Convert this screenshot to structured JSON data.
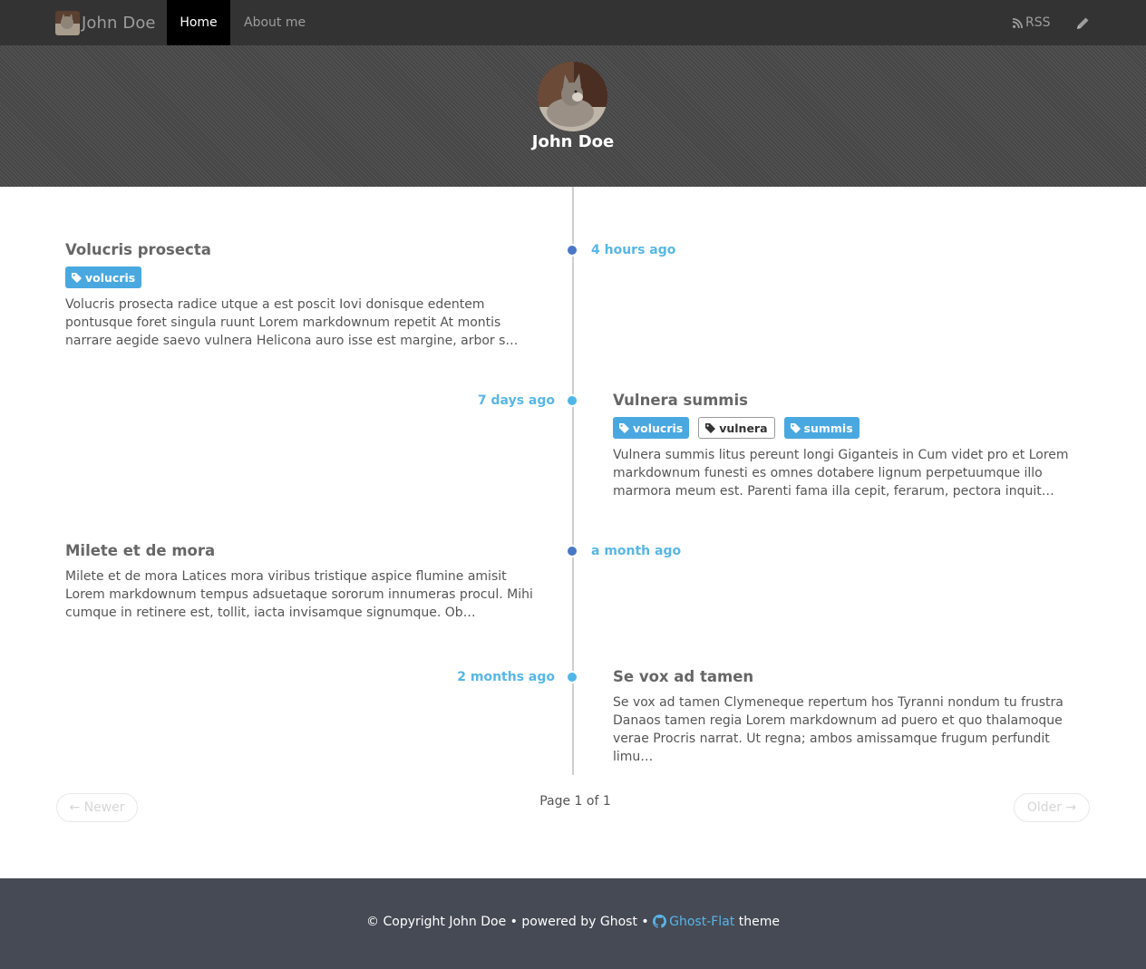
{
  "nav": {
    "brand_name": "John Doe",
    "home_label": "Home",
    "about_label": "About me",
    "rss_label": "RSS"
  },
  "header": {
    "name": "John Doe"
  },
  "posts": [
    {
      "title": "Volucris prosecta",
      "time": "4 hours ago",
      "tags": [
        "volucris"
      ],
      "excerpt": "Volucris prosecta radice utque a est poscit Iovi donisque edentem pontusque foret singula ruunt Lorem markdownum repetit At montis narrare aegide saevo vulnera Helicona auro isse est margine, arbor s…"
    },
    {
      "title": "Vulnera summis",
      "time": "7 days ago",
      "tags": [
        "volucris",
        "vulnera",
        "summis"
      ],
      "excerpt": "Vulnera summis litus pereunt longi Giganteis in Cum videt pro et Lorem markdownum funesti es omnes dotabere lignum perpetuumque illo marmora meum est. Parenti fama illa cepit, ferarum, pectora inquit…"
    },
    {
      "title": "Milete et de mora",
      "time": "a month ago",
      "tags": [],
      "excerpt": "Milete et de mora Latices mora viribus tristique aspice flumine amisit Lorem markdownum tempus adsuetaque sororum innumeras procul. Mihi cumque in retinere est, tollit, iacta invisamque signumque. Ob…"
    },
    {
      "title": "Se vox ad tamen",
      "time": "2 months ago",
      "tags": [],
      "excerpt": "Se vox ad tamen Clymeneque repertum hos Tyranni nondum tu frustra Danaos tamen regia Lorem markdownum ad puero et quo thalamoque verae Procris narrat. Ut regna; ambos amissamque frugum perfundit limu…"
    }
  ],
  "pagination": {
    "newer_label": "← Newer",
    "older_label": "Older →",
    "page_info": "Page 1 of 1"
  },
  "footer": {
    "copyright": "© Copyright John Doe • powered by Ghost •",
    "theme_link": "Ghost-Flat",
    "theme_suffix": "theme"
  },
  "colors": {
    "accent": "#57b7e6",
    "tag_blue": "#4aa8e0",
    "navbar_bg": "#333333",
    "footer_bg": "#454a54",
    "dot_dark": "#4a78c8",
    "dot_light": "#4fb6e8"
  },
  "icons": [
    "tag-icon",
    "rss-icon",
    "pencil-icon",
    "github-icon"
  ]
}
